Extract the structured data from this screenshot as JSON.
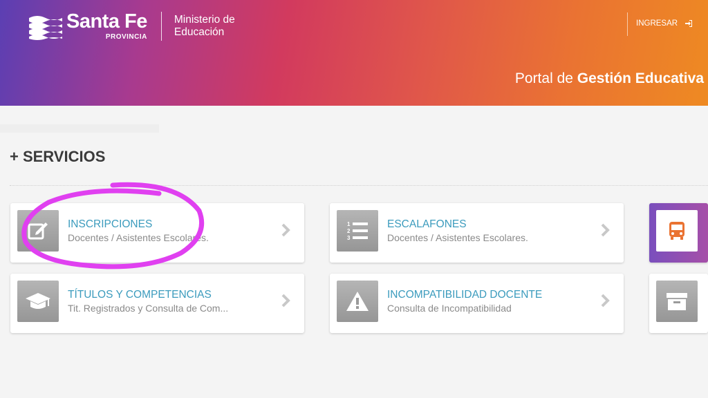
{
  "header": {
    "logo_title": "Santa Fe",
    "logo_subtitle": "PROVINCIA",
    "ministry_line1": "Ministerio de",
    "ministry_line2": "Educación",
    "login_label": "INGRESAR",
    "portal_prefix": "Portal de",
    "portal_bold": "Gestión Educativa"
  },
  "services": {
    "section_title": "+ SERVICIOS",
    "cards": [
      {
        "title": "INSCRIPCIONES",
        "description": "Docentes / Asistentes Escolares.",
        "icon": "edit-icon"
      },
      {
        "title": "ESCALAFONES",
        "description": "Docentes / Asistentes Escolares.",
        "icon": "numbered-list-icon"
      },
      {
        "title": "",
        "description": "",
        "icon": "bus-icon"
      },
      {
        "title": "TÍTULOS Y COMPETENCIAS",
        "description": "Tit. Registrados y Consulta de Com...",
        "icon": "graduation-cap-icon"
      },
      {
        "title": "INCOMPATIBILIDAD DOCENTE",
        "description": "Consulta de Incompatibilidad",
        "icon": "warning-icon"
      },
      {
        "title": "",
        "description": "",
        "icon": "archive-box-icon"
      }
    ]
  },
  "colors": {
    "card_title": "#3b9bbd",
    "highlight_stroke": "#e040f0",
    "section_text": "#3a3a3a"
  }
}
